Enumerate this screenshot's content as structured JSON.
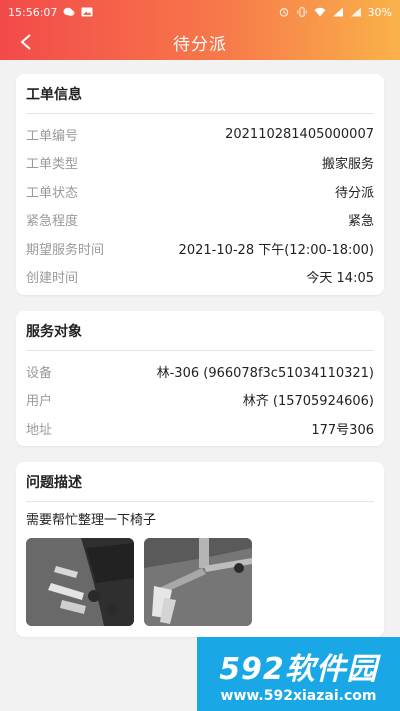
{
  "status_bar": {
    "time": "15:56:07",
    "battery": "30%",
    "left_icons": [
      "wechat-icon",
      "image-icon"
    ],
    "right_icons": [
      "alarm-icon",
      "vibrate-icon",
      "wifi-icon",
      "signal-icon",
      "signal-icon"
    ]
  },
  "nav": {
    "title": "待分派",
    "back_icon": "chevron-left-icon"
  },
  "work_order": {
    "title": "工单信息",
    "rows": [
      {
        "label": "工单编号",
        "value": "202110281405000007"
      },
      {
        "label": "工单类型",
        "value": "搬家服务"
      },
      {
        "label": "工单状态",
        "value": "待分派"
      },
      {
        "label": "紧急程度",
        "value": "紧急"
      },
      {
        "label": "期望服务时间",
        "value": "2021-10-28 下午(12:00-18:00)"
      },
      {
        "label": "创建时间",
        "value": "今天 14:05"
      }
    ]
  },
  "service_target": {
    "title": "服务对象",
    "rows": [
      {
        "label": "设备",
        "value": "林-306 (966078f3c51034110321)"
      },
      {
        "label": "用户",
        "value": "林齐 (15705924606)"
      },
      {
        "label": "地址",
        "value": "177号306"
      }
    ]
  },
  "problem": {
    "title": "问题描述",
    "text": "需要帮忙整理一下椅子",
    "photos": [
      "chair-photo-1",
      "chair-photo-2"
    ]
  },
  "watermark": {
    "main": "592软件园",
    "url": "www.592xiazai.com"
  },
  "colors": {
    "header_start": "#f24a4a",
    "header_end": "#f9b24a",
    "watermark_bg": "#1aa7e6"
  }
}
